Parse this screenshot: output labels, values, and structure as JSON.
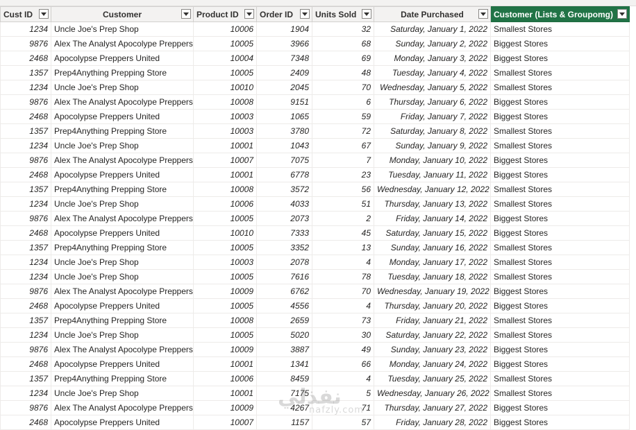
{
  "columns": [
    {
      "key": "cust_id",
      "label": "Cust ID"
    },
    {
      "key": "customer",
      "label": "Customer"
    },
    {
      "key": "product_id",
      "label": "Product ID"
    },
    {
      "key": "order_id",
      "label": "Order ID"
    },
    {
      "key": "units_sold",
      "label": "Units Sold"
    },
    {
      "key": "date_purchased",
      "label": "Date Purchased"
    },
    {
      "key": "group",
      "label": "Customer (Lists & Groupomg)"
    }
  ],
  "rows": [
    {
      "cust_id": "1234",
      "customer": "Uncle Joe's Prep Shop",
      "product_id": "10006",
      "order_id": "1904",
      "units_sold": "32",
      "date_purchased": "Saturday, January 1, 2022",
      "group": "Smallest Stores"
    },
    {
      "cust_id": "9876",
      "customer": "Alex The Analyst Apocolype Preppers",
      "product_id": "10005",
      "order_id": "3966",
      "units_sold": "68",
      "date_purchased": "Sunday, January 2, 2022",
      "group": "Biggest Stores"
    },
    {
      "cust_id": "2468",
      "customer": "Apocolypse Preppers United",
      "product_id": "10004",
      "order_id": "7348",
      "units_sold": "69",
      "date_purchased": "Monday, January 3, 2022",
      "group": "Biggest Stores"
    },
    {
      "cust_id": "1357",
      "customer": "Prep4Anything Prepping Store",
      "product_id": "10005",
      "order_id": "2409",
      "units_sold": "48",
      "date_purchased": "Tuesday, January 4, 2022",
      "group": "Smallest Stores"
    },
    {
      "cust_id": "1234",
      "customer": "Uncle Joe's Prep Shop",
      "product_id": "10010",
      "order_id": "2045",
      "units_sold": "70",
      "date_purchased": "Wednesday, January 5, 2022",
      "group": "Smallest Stores"
    },
    {
      "cust_id": "9876",
      "customer": "Alex The Analyst Apocolype Preppers",
      "product_id": "10008",
      "order_id": "9151",
      "units_sold": "6",
      "date_purchased": "Thursday, January 6, 2022",
      "group": "Biggest Stores"
    },
    {
      "cust_id": "2468",
      "customer": "Apocolypse Preppers United",
      "product_id": "10003",
      "order_id": "1065",
      "units_sold": "59",
      "date_purchased": "Friday, January 7, 2022",
      "group": "Biggest Stores"
    },
    {
      "cust_id": "1357",
      "customer": "Prep4Anything Prepping Store",
      "product_id": "10003",
      "order_id": "3780",
      "units_sold": "72",
      "date_purchased": "Saturday, January 8, 2022",
      "group": "Smallest Stores"
    },
    {
      "cust_id": "1234",
      "customer": "Uncle Joe's Prep Shop",
      "product_id": "10001",
      "order_id": "1043",
      "units_sold": "67",
      "date_purchased": "Sunday, January 9, 2022",
      "group": "Smallest Stores"
    },
    {
      "cust_id": "9876",
      "customer": "Alex The Analyst Apocolype Preppers",
      "product_id": "10007",
      "order_id": "7075",
      "units_sold": "7",
      "date_purchased": "Monday, January 10, 2022",
      "group": "Biggest Stores"
    },
    {
      "cust_id": "2468",
      "customer": "Apocolypse Preppers United",
      "product_id": "10001",
      "order_id": "6778",
      "units_sold": "23",
      "date_purchased": "Tuesday, January 11, 2022",
      "group": "Biggest Stores"
    },
    {
      "cust_id": "1357",
      "customer": "Prep4Anything Prepping Store",
      "product_id": "10008",
      "order_id": "3572",
      "units_sold": "56",
      "date_purchased": "Wednesday, January 12, 2022",
      "group": "Smallest Stores"
    },
    {
      "cust_id": "1234",
      "customer": "Uncle Joe's Prep Shop",
      "product_id": "10006",
      "order_id": "4033",
      "units_sold": "51",
      "date_purchased": "Thursday, January 13, 2022",
      "group": "Smallest Stores"
    },
    {
      "cust_id": "9876",
      "customer": "Alex The Analyst Apocolype Preppers",
      "product_id": "10005",
      "order_id": "2073",
      "units_sold": "2",
      "date_purchased": "Friday, January 14, 2022",
      "group": "Biggest Stores"
    },
    {
      "cust_id": "2468",
      "customer": "Apocolypse Preppers United",
      "product_id": "10010",
      "order_id": "7333",
      "units_sold": "45",
      "date_purchased": "Saturday, January 15, 2022",
      "group": "Biggest Stores"
    },
    {
      "cust_id": "1357",
      "customer": "Prep4Anything Prepping Store",
      "product_id": "10005",
      "order_id": "3352",
      "units_sold": "13",
      "date_purchased": "Sunday, January 16, 2022",
      "group": "Smallest Stores"
    },
    {
      "cust_id": "1234",
      "customer": "Uncle Joe's Prep Shop",
      "product_id": "10003",
      "order_id": "2078",
      "units_sold": "4",
      "date_purchased": "Monday, January 17, 2022",
      "group": "Smallest Stores"
    },
    {
      "cust_id": "1234",
      "customer": "Uncle Joe's Prep Shop",
      "product_id": "10005",
      "order_id": "7616",
      "units_sold": "78",
      "date_purchased": "Tuesday, January 18, 2022",
      "group": "Smallest Stores"
    },
    {
      "cust_id": "9876",
      "customer": "Alex The Analyst Apocolype Preppers",
      "product_id": "10009",
      "order_id": "6762",
      "units_sold": "70",
      "date_purchased": "Wednesday, January 19, 2022",
      "group": "Biggest Stores"
    },
    {
      "cust_id": "2468",
      "customer": "Apocolypse Preppers United",
      "product_id": "10005",
      "order_id": "4556",
      "units_sold": "4",
      "date_purchased": "Thursday, January 20, 2022",
      "group": "Biggest Stores"
    },
    {
      "cust_id": "1357",
      "customer": "Prep4Anything Prepping Store",
      "product_id": "10008",
      "order_id": "2659",
      "units_sold": "73",
      "date_purchased": "Friday, January 21, 2022",
      "group": "Smallest Stores"
    },
    {
      "cust_id": "1234",
      "customer": "Uncle Joe's Prep Shop",
      "product_id": "10005",
      "order_id": "5020",
      "units_sold": "30",
      "date_purchased": "Saturday, January 22, 2022",
      "group": "Smallest Stores"
    },
    {
      "cust_id": "9876",
      "customer": "Alex The Analyst Apocolype Preppers",
      "product_id": "10009",
      "order_id": "3887",
      "units_sold": "49",
      "date_purchased": "Sunday, January 23, 2022",
      "group": "Biggest Stores"
    },
    {
      "cust_id": "2468",
      "customer": "Apocolypse Preppers United",
      "product_id": "10001",
      "order_id": "1341",
      "units_sold": "66",
      "date_purchased": "Monday, January 24, 2022",
      "group": "Biggest Stores"
    },
    {
      "cust_id": "1357",
      "customer": "Prep4Anything Prepping Store",
      "product_id": "10006",
      "order_id": "8459",
      "units_sold": "4",
      "date_purchased": "Tuesday, January 25, 2022",
      "group": "Smallest Stores"
    },
    {
      "cust_id": "1234",
      "customer": "Uncle Joe's Prep Shop",
      "product_id": "10001",
      "order_id": "7175",
      "units_sold": "5",
      "date_purchased": "Wednesday, January 26, 2022",
      "group": "Smallest Stores"
    },
    {
      "cust_id": "9876",
      "customer": "Alex The Analyst Apocolype Preppers",
      "product_id": "10009",
      "order_id": "4267",
      "units_sold": "71",
      "date_purchased": "Thursday, January 27, 2022",
      "group": "Biggest Stores"
    },
    {
      "cust_id": "2468",
      "customer": "Apocolypse Preppers United",
      "product_id": "10007",
      "order_id": "1157",
      "units_sold": "57",
      "date_purchased": "Friday, January 28, 2022",
      "group": "Biggest Stores"
    }
  ],
  "watermark": {
    "text": "نفذلي",
    "subtext": "nafzly.com"
  },
  "colors": {
    "highlight_header": "#217346",
    "header_bg": "#f3f2f1",
    "grid_line": "#edebe9"
  }
}
